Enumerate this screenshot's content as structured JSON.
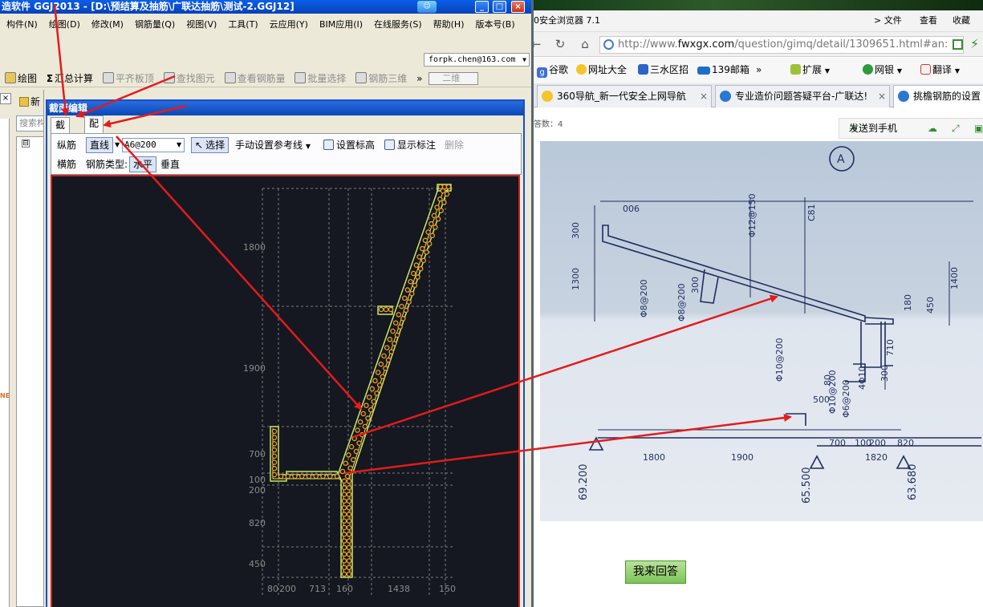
{
  "app": {
    "title": "造软件 GGJ2013 - [D:\\预结算及抽筋\\广联达抽筋\\测试-2.GGJ12]",
    "window_controls": {
      "minimize": "_",
      "maximize": "□",
      "close": "×"
    },
    "menu": [
      "构件(N)",
      "绘图(D)",
      "修改(M)",
      "钢筋量(Q)",
      "视图(V)",
      "工具(T)",
      "云应用(Y)",
      "BIM应用(I)",
      "在线服务(S)",
      "帮助(H)",
      "版本号(B)"
    ],
    "user": "forpk.chen@163.com",
    "toolbar": {
      "draw": "绘图",
      "sum_calc": "汇总计算",
      "flush_slab": "平齐板顶",
      "find_element": "查找图元",
      "view_rebar_qty": "查看钢筋量",
      "batch_select": "批量选择",
      "rebar_3d": "钢筋三维",
      "overflow": "»",
      "view_mode": "二维"
    },
    "side": {
      "close": "×",
      "new_label": "新",
      "search_placeholder": "搜索构",
      "tree_toggle": "⊟",
      "partial_text": "NE"
    }
  },
  "dialog": {
    "title": "截面编辑",
    "tabs": [
      "截面",
      "配筋"
    ],
    "row1": {
      "longitudinal": "纵筋",
      "line_type": "直线",
      "spec_value": "A6@200",
      "select": "选择",
      "manual_ref": "手动设置参考线",
      "set_elevation": "设置标高",
      "show_label": "显示标注",
      "delete": "删除"
    },
    "row2": {
      "transverse": "横筋",
      "rebar_type_label": "钢筋类型:",
      "horizontal": "水平",
      "vertical": "垂直"
    },
    "canvas": {
      "y_labels": [
        "1800",
        "1900",
        "700",
        "100",
        "200",
        "820",
        "450"
      ],
      "x_labels": [
        "80",
        "200",
        "713",
        "160",
        "1438",
        "150"
      ]
    }
  },
  "browser": {
    "name": "0安全浏览器 7.1",
    "menu": [
      ">  文件",
      "查看",
      "收藏"
    ],
    "url_host": "http://www.",
    "url_domain": "fwxgx.com",
    "url_path": "/question/gimq/detail/1309651.html#an:",
    "bookmarks": [
      "谷歌",
      "网址大全",
      "三水区招",
      "139邮箱",
      "»",
      "扩展",
      "网银",
      "翻译"
    ],
    "tabs": [
      {
        "label": "360导航_新一代安全上网导航",
        "close": "×"
      },
      {
        "label": "专业造价问题答疑平台-广联达!",
        "close": "×"
      },
      {
        "label": "挑檐钢筋的设置"
      }
    ],
    "answer_count": "答数：4",
    "send_to_phone": "发送到手机",
    "answer_button": "我来回答",
    "colors": {
      "accent_green": "#7dc35a",
      "arrow_red": "#e41b1b"
    }
  },
  "drawing": {
    "labels": [
      "A",
      "006",
      "300",
      "1300",
      "Φ12@150",
      "C81",
      "Φ8@200",
      "300",
      "Φ8@200",
      "180",
      "1400",
      "450",
      "710",
      "Φ10@200",
      "80",
      "300",
      "4Φ10",
      "500",
      "Φ10@200",
      "Φ6@200",
      "700",
      "100",
      "200",
      "820",
      "1800",
      "1900",
      "1820",
      "69.200",
      "65.500",
      "63.680"
    ]
  }
}
